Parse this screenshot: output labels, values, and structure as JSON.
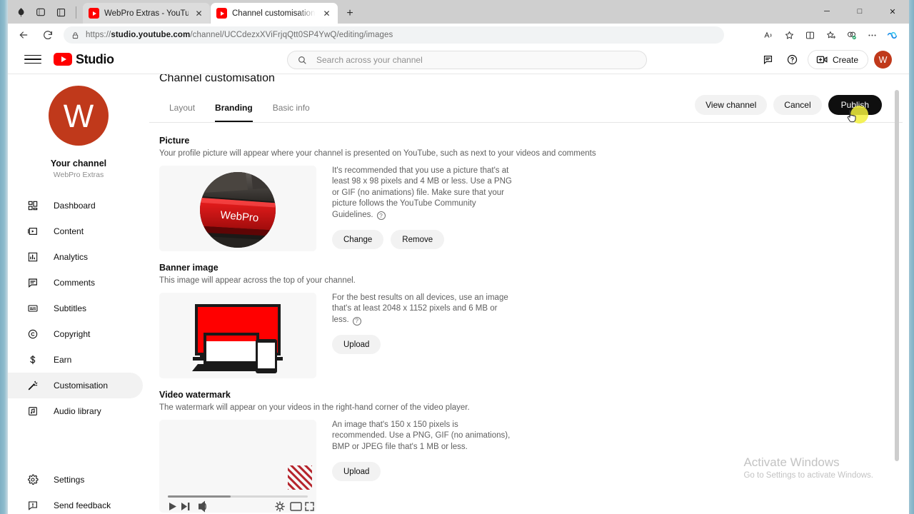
{
  "browser": {
    "tabs": [
      {
        "title": "WebPro Extras - YouTube",
        "favicon": "youtube-icon",
        "active": false
      },
      {
        "title": "Channel customisation - YouTube",
        "favicon": "youtube-icon",
        "active": true
      }
    ],
    "new_tab_label": "+",
    "url_prefix": "https://",
    "url_domain": "studio.youtube.com",
    "url_path": "/channel/UCCdezxXViFrjqQtt0SP4YwQ/editing/images",
    "window_controls": {
      "minimize": "─",
      "maximize": "□",
      "close": "✕"
    },
    "toolbar_icons": [
      "read-aloud-icon",
      "favorite-star-icon",
      "split-screen-icon",
      "collections-icon",
      "browser-essentials-icon",
      "more-options-icon",
      "copilot-icon"
    ],
    "nav_icons": [
      "back-icon",
      "refresh-icon",
      "site-lock-icon"
    ]
  },
  "studio_header": {
    "menu_icon": "hamburger-menu-icon",
    "logo_text": "Studio",
    "search": {
      "placeholder": "Search across your channel",
      "value": "",
      "icon": "search-icon"
    },
    "feedback_icon": "feedback-icon",
    "help_icon": "help-icon",
    "create_label": "Create",
    "create_icon": "create-video-icon",
    "avatar_initial": "W"
  },
  "sidebar": {
    "avatar_initial": "W",
    "channel_title": "Your channel",
    "channel_subtitle": "WebPro Extras",
    "items": [
      {
        "label": "Dashboard",
        "icon": "dashboard-icon",
        "active": false
      },
      {
        "label": "Content",
        "icon": "content-video-icon",
        "active": false
      },
      {
        "label": "Analytics",
        "icon": "analytics-bar-icon",
        "active": false
      },
      {
        "label": "Comments",
        "icon": "comments-icon",
        "active": false
      },
      {
        "label": "Subtitles",
        "icon": "subtitles-icon",
        "active": false
      },
      {
        "label": "Copyright",
        "icon": "copyright-icon",
        "active": false
      },
      {
        "label": "Earn",
        "icon": "earn-dollar-icon",
        "active": false
      },
      {
        "label": "Customisation",
        "icon": "magic-wand-icon",
        "active": true
      },
      {
        "label": "Audio library",
        "icon": "audio-note-icon",
        "active": false
      }
    ],
    "bottom_items": [
      {
        "label": "Settings",
        "icon": "gear-icon"
      },
      {
        "label": "Send feedback",
        "icon": "send-feedback-icon"
      }
    ]
  },
  "page": {
    "title": "Channel customisation",
    "tabs": [
      {
        "label": "Layout",
        "active": false
      },
      {
        "label": "Branding",
        "active": true
      },
      {
        "label": "Basic info",
        "active": false
      }
    ],
    "actions": [
      {
        "label": "View channel",
        "style": "light"
      },
      {
        "label": "Cancel",
        "style": "light"
      },
      {
        "label": "Publish",
        "style": "dark"
      }
    ]
  },
  "sections": [
    {
      "title": "Picture",
      "description": "Your profile picture will appear where your channel is presented on YouTube, such as next to your videos and comments",
      "info": "It's recommended that you use a picture that's at least 98 x 98 pixels and 4 MB or less. Use a PNG or GIF (no animations) file. Make sure that your picture follows the YouTube Community Guidelines.",
      "help_icon": "help-icon",
      "buttons": [
        "Change",
        "Remove"
      ],
      "preview": "profile-photo-webpro-key"
    },
    {
      "title": "Banner image",
      "description": "This image will appear across the top of your channel.",
      "info": "For the best results on all devices, use an image that's at least 2048 x 1152 pixels and 6 MB or less.",
      "help_icon": "help-icon",
      "buttons": [
        "Upload"
      ],
      "preview": "banner-devices-illustration"
    },
    {
      "title": "Video watermark",
      "description": "The watermark will appear on your videos in the right-hand corner of the video player.",
      "info": "An image that's 150 x 150 pixels is recommended. Use a PNG, GIF (no animations), BMP or JPEG file that's 1 MB or less.",
      "buttons": [
        "Upload"
      ],
      "preview": "video-player-watermark-illustration"
    }
  ],
  "video_player_mock": {
    "progress_percent": 45,
    "left_controls": [
      "play-icon",
      "next-icon",
      "volume-icon"
    ],
    "right_controls": [
      "settings-gear-icon",
      "miniplayer-icon",
      "fullscreen-icon"
    ]
  },
  "watermark": {
    "line1": "Activate Windows",
    "line2": "Go to Settings to activate Windows."
  },
  "colors": {
    "youtube_red": "#ff0000",
    "avatar_orange": "#c0391b",
    "publish_dark": "#0f0f0f",
    "cursor_highlight": "#f2f03c"
  }
}
